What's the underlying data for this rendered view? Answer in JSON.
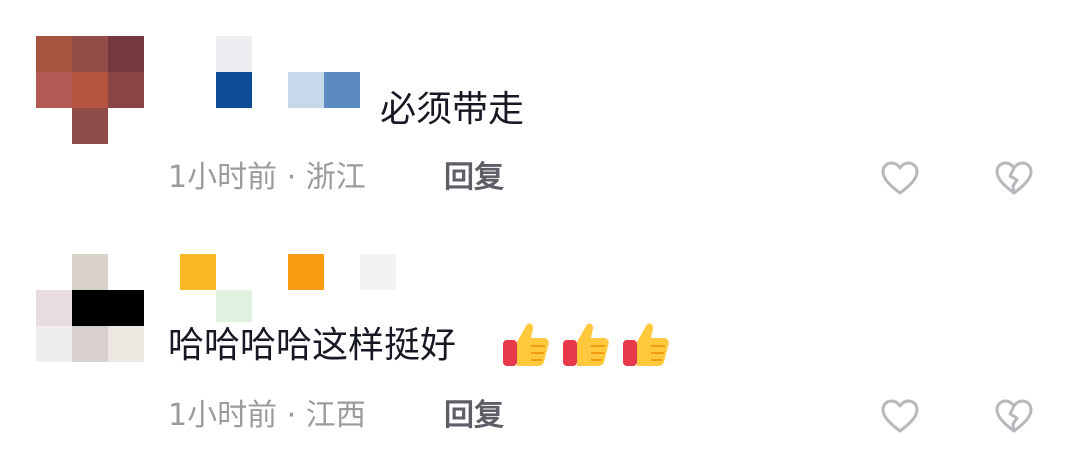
{
  "comments": [
    {
      "text": "必须带走",
      "time": "1小时前",
      "separator": "·",
      "location": "浙江",
      "reply_label": "回复",
      "avatar_colors": [
        "#a6533f",
        "#934c47",
        "#75383f",
        "#b05a53",
        "#b5543f",
        "#8a4544",
        "#8e4c48"
      ],
      "name_colors": [
        "#eceef1",
        "#0e4c98",
        "#c7d8ea",
        "#5d8ac0"
      ],
      "emojis": []
    },
    {
      "text": "哈哈哈哈这样挺好",
      "time": "1小时前",
      "separator": "·",
      "location": "江西",
      "reply_label": "回复",
      "avatar_colors": [
        "#d8d1c8",
        "#e7dde0",
        "#000000",
        "#efedef",
        "#d8cfcf",
        "#ece8e1"
      ],
      "name_colors": [
        "#fbb927",
        "#fa9d12",
        "#f1f2f3",
        "#e1f1e0"
      ],
      "emojis": [
        "thumbs-up",
        "thumbs-up",
        "thumbs-up"
      ]
    }
  ],
  "icons": {
    "like": "heart-outline-icon",
    "dislike": "broken-heart-outline-icon"
  }
}
